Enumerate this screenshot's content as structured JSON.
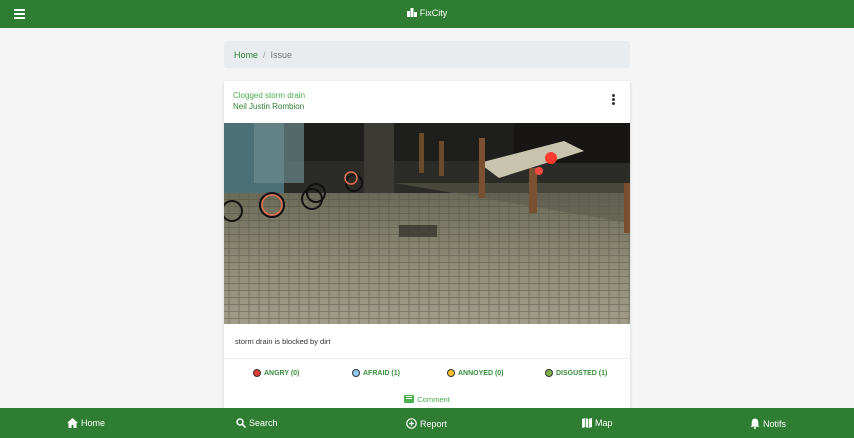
{
  "header": {
    "app_title": "FixCity",
    "menu_icon": "hamburger-icon",
    "brand_icon": "city-icon"
  },
  "breadcrumb": {
    "home": "Home",
    "separator": "/",
    "current": "Issue"
  },
  "issue": {
    "title": "Clogged storm drain",
    "author": "Neil Justin Rombion",
    "description": "storm drain is blocked by dirt",
    "image_icon": "issue-photo",
    "reactions": [
      {
        "label": "ANGRY (0)",
        "color": "#e53935"
      },
      {
        "label": "AFRAID (1)",
        "color": "#90caf9"
      },
      {
        "label": "ANNOYED (0)",
        "color": "#fbc02d"
      },
      {
        "label": "DISGUSTED (1)",
        "color": "#7cb342"
      }
    ],
    "comment_label": "Comment"
  },
  "bottom_nav": {
    "home": "Home",
    "search": "Search",
    "report": "Report",
    "map": "Map",
    "notifs": "Notifs"
  },
  "colors": {
    "primary": "#2e7d32",
    "accent": "#4caf50"
  }
}
